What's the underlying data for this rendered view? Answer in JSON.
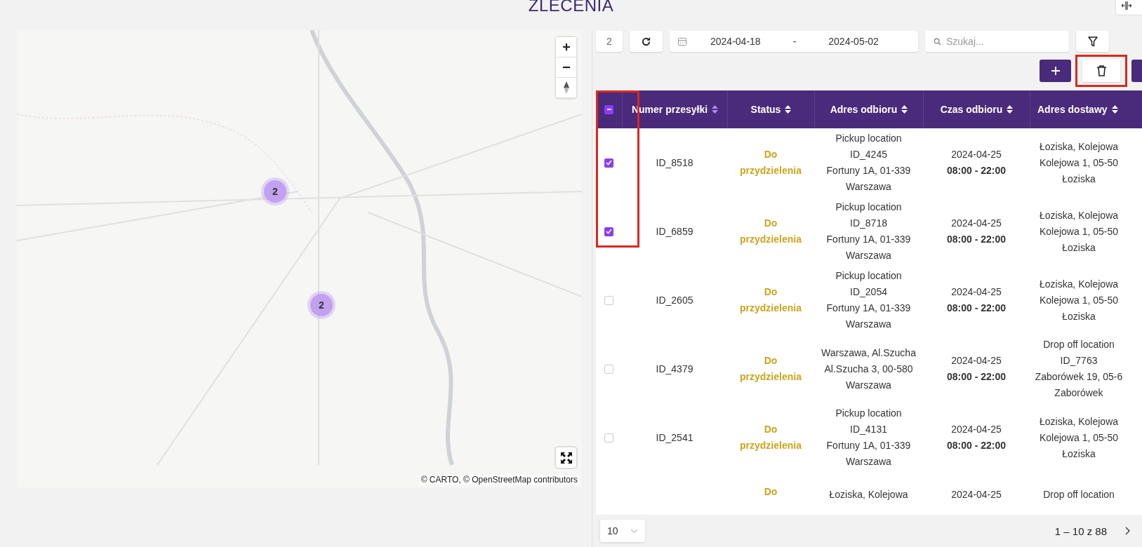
{
  "page_title": "ZLECENIA",
  "map": {
    "clusters": [
      {
        "count": "2"
      },
      {
        "count": "2"
      }
    ],
    "attribution": "© CARTO, © OpenStreetMap contributors"
  },
  "toolbar": {
    "selected_count": "2",
    "date_from": "2024-04-18",
    "date_separator": "-",
    "date_to": "2024-05-02",
    "search": {
      "placeholder": "Szukaj..."
    }
  },
  "table": {
    "select_all": {
      "partial": true
    },
    "columns": [
      {
        "label": "Numer przesyłki",
        "sort_active": true
      },
      {
        "label": "Status",
        "sort_active": false
      },
      {
        "label": "Adres odbioru",
        "sort_active": false
      },
      {
        "label": "Czas odbioru",
        "sort_active": false
      },
      {
        "label": "Adres dostawy",
        "sort_active": false
      }
    ],
    "rows": [
      {
        "checked": true,
        "id": "ID_8518",
        "status": "Do przydzielenia",
        "pickup": [
          "Pickup location",
          "ID_4245",
          "Fortuny 1A, 01-339",
          "Warszawa"
        ],
        "date": "2024-04-25",
        "time": "08:00 - 22:00",
        "delivery": [
          "Łoziska, Kolejowa",
          "Kolejowa 1, 05-50",
          "Łoziska"
        ]
      },
      {
        "checked": true,
        "id": "ID_6859",
        "status": "Do przydzielenia",
        "pickup": [
          "Pickup location",
          "ID_8718",
          "Fortuny 1A, 01-339",
          "Warszawa"
        ],
        "date": "2024-04-25",
        "time": "08:00 - 22:00",
        "delivery": [
          "Łoziska, Kolejowa",
          "Kolejowa 1, 05-50",
          "Łoziska"
        ]
      },
      {
        "checked": false,
        "id": "ID_2605",
        "status": "Do przydzielenia",
        "pickup": [
          "Pickup location",
          "ID_2054",
          "Fortuny 1A, 01-339",
          "Warszawa"
        ],
        "date": "2024-04-25",
        "time": "08:00 - 22:00",
        "delivery": [
          "Łoziska, Kolejowa",
          "Kolejowa 1, 05-50",
          "Łoziska"
        ]
      },
      {
        "checked": false,
        "id": "ID_4379",
        "status": "Do przydzielenia",
        "pickup": [
          "Warszawa, Al.Szucha",
          "Al.Szucha 3, 00-580",
          "Warszawa"
        ],
        "date": "2024-04-25",
        "time": "08:00 - 22:00",
        "delivery": [
          "Drop off location",
          "ID_7763",
          "Zaborówek 19, 05-6",
          "Zaborówek"
        ]
      },
      {
        "checked": false,
        "id": "ID_2541",
        "status": "Do przydzielenia",
        "pickup": [
          "Pickup location",
          "ID_4131",
          "Fortuny 1A, 01-339",
          "Warszawa"
        ],
        "date": "2024-04-25",
        "time": "08:00 - 22:00",
        "delivery": [
          "Łoziska, Kolejowa",
          "Kolejowa 1, 05-50",
          "Łoziska"
        ]
      }
    ],
    "partial_row": {
      "status": "Do",
      "pickup": "Łoziska, Kolejowa",
      "date": "2024-04-25",
      "delivery": "Drop off location"
    }
  },
  "pagination": {
    "page_size": "10",
    "range": "1 – 10 z 88"
  }
}
